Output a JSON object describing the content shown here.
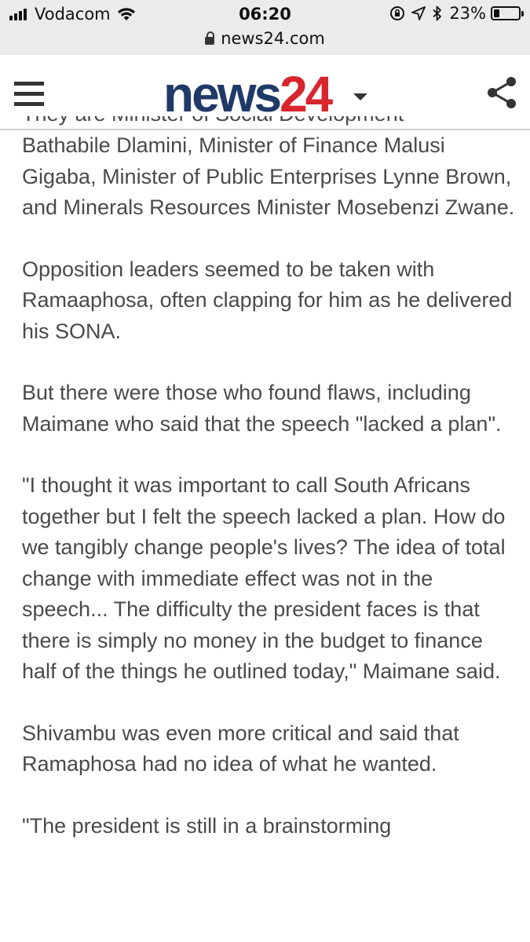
{
  "status_bar": {
    "carrier": "Vodacom",
    "time": "06:20",
    "battery_percent": "23%",
    "battery_level": 0.23,
    "icons": [
      "signal-icon",
      "wifi-icon",
      "orientation-lock-icon",
      "location-icon",
      "bluetooth-icon",
      "battery-icon"
    ]
  },
  "browser": {
    "url": "news24.com"
  },
  "header": {
    "logo_text": "news",
    "logo_number": "24",
    "colors": {
      "logo_blue": "#1f3a68",
      "logo_red": "#d7262e"
    },
    "icons": [
      "menu-icon",
      "share-icon",
      "caret-down-icon"
    ]
  },
  "article": {
    "partial_top_line": "They are Minister of Social Development",
    "paragraphs": [
      "Bathabile Dlamini, Minister of Finance Malusi Gigaba, Minister of Public Enterprises Lynne Brown, and Minerals Resources Minister Mosebenzi Zwane.",
      "Opposition leaders seemed to be taken with Ramaaphosa, often clapping for him as he delivered his SONA.",
      "But there were those who found flaws, including Maimane who said that the speech \"lacked a plan\".",
      "\"I thought it was important to call South Africans together but I felt the speech lacked a plan. How do we tangibly change people's lives? The idea of total change with immediate effect was not in the speech... The difficulty the president faces is that there is simply no money in the budget to finance half of the things he outlined today,\" Maimane said.",
      "Shivambu was even more critical and said that Ramaphosa had no idea of what he wanted.",
      "\"The president is still in a brainstorming"
    ]
  }
}
